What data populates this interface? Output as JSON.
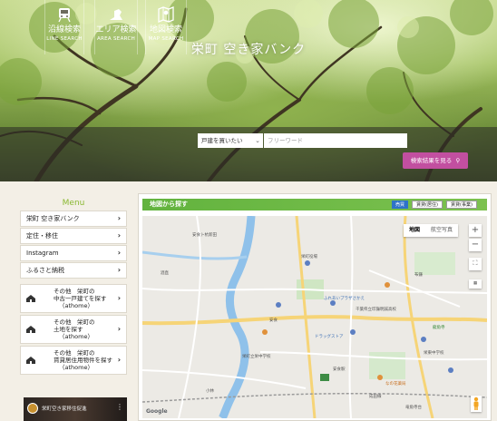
{
  "site": {
    "title": "栄町 空き家バンク"
  },
  "search": {
    "buttons": [
      {
        "jp": "沿線検索",
        "en": "LINE SEARCH",
        "icon": "train-icon"
      },
      {
        "jp": "エリア検索",
        "en": "AREA SEARCH",
        "icon": "area-map-icon"
      },
      {
        "jp": "地図検索",
        "en": "MAP SEARCH",
        "icon": "folded-map-icon"
      }
    ],
    "select_value": "戸建を買いたい",
    "free_placeholder": "フリーワード",
    "result_button": "検索結果を見る"
  },
  "sidebar": {
    "menu_title": "Menu",
    "items": [
      {
        "label": "栄町 空き家バンク"
      },
      {
        "label": "定住・移住"
      },
      {
        "label": "Instagram"
      },
      {
        "label": "ふるさと納税"
      }
    ],
    "external": [
      {
        "line1": "その他　栄町の",
        "line2": "中古一戸建てを探す",
        "line3": "（athome）"
      },
      {
        "line1": "その他　栄町の",
        "line2": "土地を探す",
        "line3": "（athome）"
      },
      {
        "line1": "その他　栄町の",
        "line2": "賃貸居住用物件を探す",
        "line3": "（athome）"
      }
    ],
    "video_title": "栄町空き家移住促進"
  },
  "map": {
    "header_title": "地図から探す",
    "header_buttons": [
      "売買",
      "賃貸(居住)",
      "賃貸(事業)"
    ],
    "type_map": "地図",
    "type_satellite": "航空写真",
    "zoom_in": "+",
    "zoom_out": "−",
    "google": "Google",
    "labels": [
      "安食卜杭新田",
      "栄町役場",
      "ふれあいプラザさかえ",
      "布鎌",
      "安食",
      "安食駅",
      "ドラッグストア",
      "栄町立栄中学校",
      "成田線",
      "千葉県立印旛明誠高校",
      "なの花薬局",
      "竜角寺台",
      "酒直",
      "龍角寺",
      "小林",
      "栄東中学校"
    ]
  },
  "colors": {
    "menu_green": "#8ab832",
    "result_magenta": "#c24fa0",
    "header_green": "#62b33e",
    "river": "#8fc1ea",
    "active_blue": "#2e73c9"
  }
}
